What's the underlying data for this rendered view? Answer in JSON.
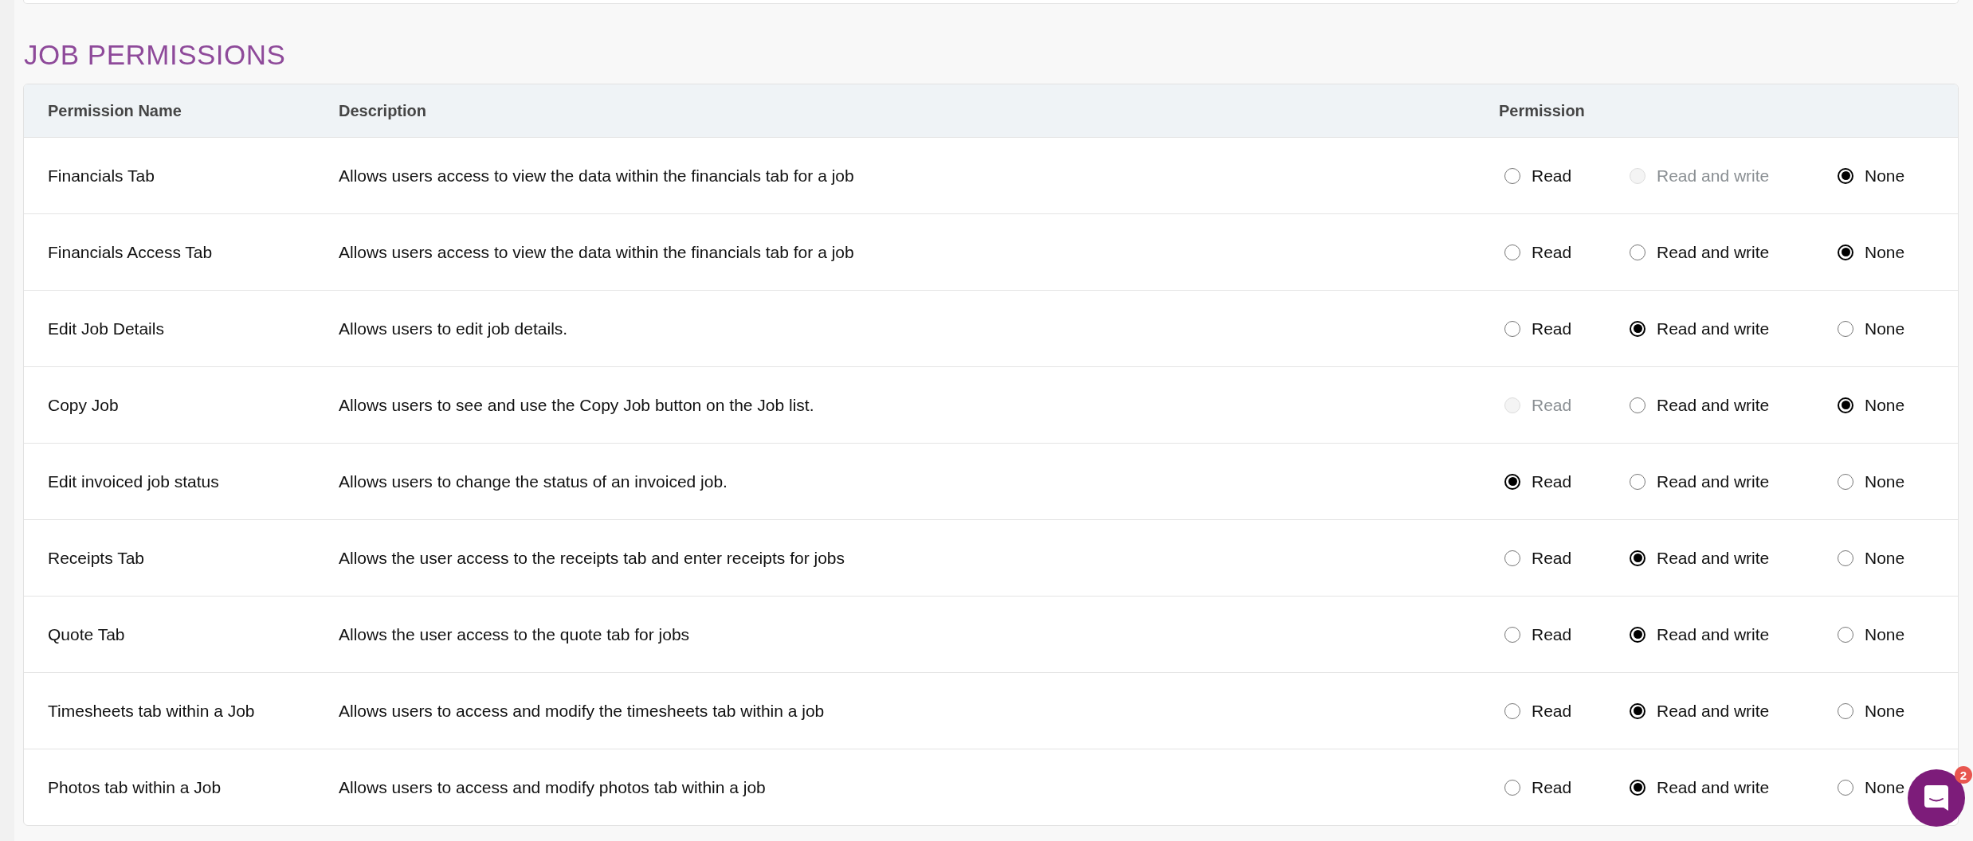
{
  "section_title": "JOB PERMISSIONS",
  "table": {
    "columns": [
      "Permission Name",
      "Description",
      "Permission"
    ],
    "rows": [
      {
        "name": "Financials Tab",
        "description": "Allows users access to view the data within the financials tab for a job",
        "options": [
          {
            "label": "Read",
            "selected": false,
            "disabled": false
          },
          {
            "label": "Read and write",
            "selected": false,
            "disabled": true
          },
          {
            "label": "None",
            "selected": true,
            "disabled": false
          }
        ]
      },
      {
        "name": "Financials Access Tab",
        "description": "Allows users access to view the data within the financials tab for a job",
        "options": [
          {
            "label": "Read",
            "selected": false,
            "disabled": false
          },
          {
            "label": "Read and write",
            "selected": false,
            "disabled": false
          },
          {
            "label": "None",
            "selected": true,
            "disabled": false
          }
        ]
      },
      {
        "name": "Edit Job Details",
        "description": "Allows users to edit job details.",
        "options": [
          {
            "label": "Read",
            "selected": false,
            "disabled": false
          },
          {
            "label": "Read and write",
            "selected": true,
            "disabled": false
          },
          {
            "label": "None",
            "selected": false,
            "disabled": false
          }
        ]
      },
      {
        "name": "Copy Job",
        "description": "Allows users to see and use the Copy Job button on the Job list.",
        "options": [
          {
            "label": "Read",
            "selected": false,
            "disabled": true
          },
          {
            "label": "Read and write",
            "selected": false,
            "disabled": false
          },
          {
            "label": "None",
            "selected": true,
            "disabled": false
          }
        ]
      },
      {
        "name": "Edit invoiced job status",
        "description": "Allows users to change the status of an invoiced job.",
        "options": [
          {
            "label": "Read",
            "selected": true,
            "disabled": false
          },
          {
            "label": "Read and write",
            "selected": false,
            "disabled": false
          },
          {
            "label": "None",
            "selected": false,
            "disabled": false
          }
        ]
      },
      {
        "name": "Receipts Tab",
        "description": "Allows the user access to the receipts tab and enter receipts for jobs",
        "options": [
          {
            "label": "Read",
            "selected": false,
            "disabled": false
          },
          {
            "label": "Read and write",
            "selected": true,
            "disabled": false
          },
          {
            "label": "None",
            "selected": false,
            "disabled": false
          }
        ]
      },
      {
        "name": "Quote Tab",
        "description": "Allows the user access to the quote tab for jobs",
        "options": [
          {
            "label": "Read",
            "selected": false,
            "disabled": false
          },
          {
            "label": "Read and write",
            "selected": true,
            "disabled": false
          },
          {
            "label": "None",
            "selected": false,
            "disabled": false
          }
        ]
      },
      {
        "name": "Timesheets tab within a Job",
        "description": "Allows users to access and modify the timesheets tab within a job",
        "options": [
          {
            "label": "Read",
            "selected": false,
            "disabled": false
          },
          {
            "label": "Read and write",
            "selected": true,
            "disabled": false
          },
          {
            "label": "None",
            "selected": false,
            "disabled": false
          }
        ]
      },
      {
        "name": "Photos tab within a Job",
        "description": "Allows users to access and modify photos tab within a job",
        "options": [
          {
            "label": "Read",
            "selected": false,
            "disabled": false
          },
          {
            "label": "Read and write",
            "selected": true,
            "disabled": false
          },
          {
            "label": "None",
            "selected": false,
            "disabled": false
          }
        ]
      }
    ]
  },
  "chat": {
    "badge": "2"
  }
}
